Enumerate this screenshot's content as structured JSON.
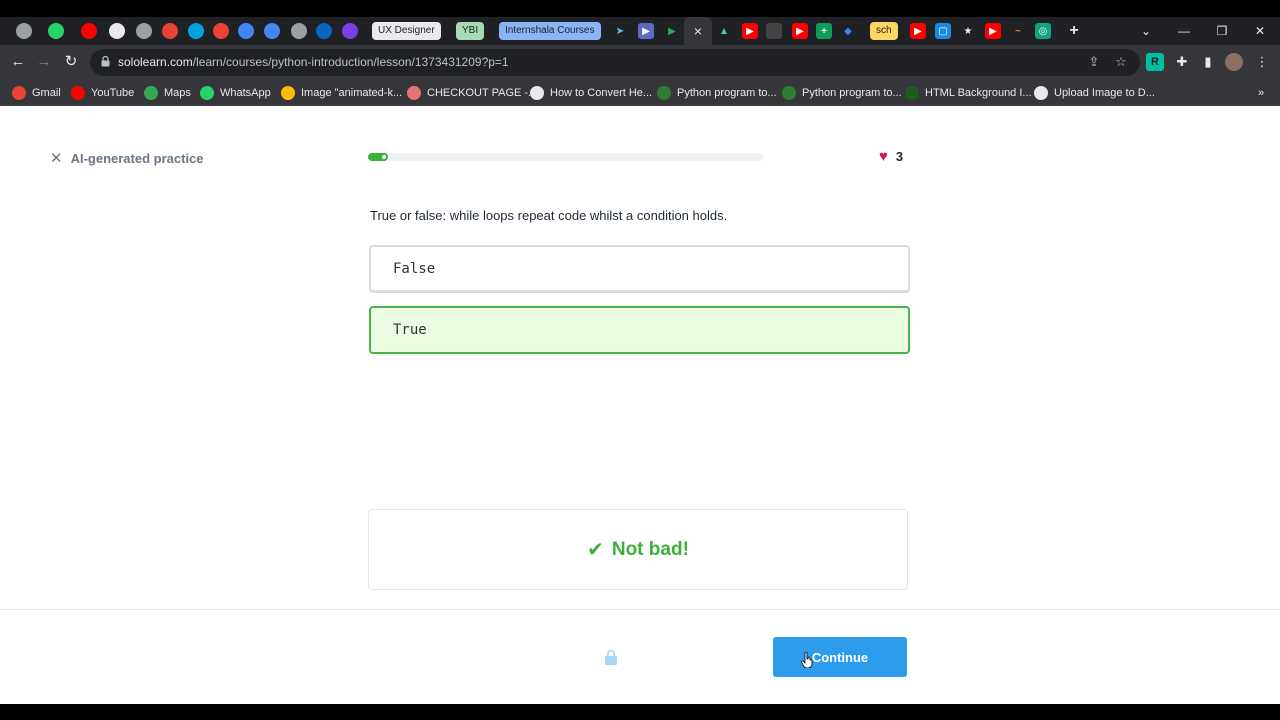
{
  "browser": {
    "tabs": [
      {
        "icon": "globe-icon",
        "color": "#9aa0a6"
      },
      {
        "icon": "whatsapp-icon",
        "color": "#25d366"
      },
      {
        "icon": "youtube-icon",
        "color": "#ff0000"
      },
      {
        "icon": "github-icon",
        "color": "#e8eaed"
      },
      {
        "icon": "globe-icon",
        "color": "#9aa0a6"
      },
      {
        "icon": "gmail-icon",
        "color": "#ea4335"
      },
      {
        "icon": "is-icon",
        "color": "#00a3e0"
      },
      {
        "icon": "gmail-icon",
        "color": "#ea4335"
      },
      {
        "icon": "kotlin-icon",
        "color": "#4285f4"
      },
      {
        "icon": "kotlin-icon",
        "color": "#4285f4"
      },
      {
        "icon": "globe-icon",
        "color": "#9aa0a6"
      },
      {
        "icon": "linkedin-icon",
        "color": "#0a66c2"
      },
      {
        "icon": "u-icon",
        "color": "#7b3fe4"
      }
    ],
    "chips": [
      {
        "label": "UX Designer",
        "color": "#e8eaed"
      },
      {
        "label": "YBI",
        "color": "#a8dab5"
      },
      {
        "label": "Internshala Courses",
        "color": "#8ab4f8"
      }
    ],
    "active_tab_close": "×",
    "url_host": "sololearn.com",
    "url_path": "/learn/courses/python-introduction/lesson/1373431209?p=1",
    "sch_chip": "sch",
    "bookmarks": [
      {
        "label": "Gmail",
        "color": "#ea4335"
      },
      {
        "label": "YouTube",
        "color": "#ff0000"
      },
      {
        "label": "Maps",
        "color": "#34a853"
      },
      {
        "label": "WhatsApp",
        "color": "#25d366"
      },
      {
        "label": "Image \"animated-k...",
        "color": "#fbbc04"
      },
      {
        "label": "CHECKOUT PAGE -...",
        "color": "#e57373"
      },
      {
        "label": "How to Convert He...",
        "color": "#e8eaed"
      },
      {
        "label": "Python program to...",
        "color": "#2e7d32"
      },
      {
        "label": "Python program to...",
        "color": "#2e7d32"
      },
      {
        "label": "HTML Background I...",
        "color": "#1b5e20"
      },
      {
        "label": "Upload Image to D...",
        "color": "#e8eaed"
      }
    ],
    "more_bookmarks": "»"
  },
  "lesson": {
    "close_label": "AI-generated practice",
    "progress_fraction": 0.05,
    "lives": "3",
    "question": "True or false: while loops repeat code whilst a condition holds.",
    "options": [
      {
        "label": "False",
        "selected": false
      },
      {
        "label": "True",
        "selected": true
      }
    ],
    "feedback": "Not bad!",
    "continue_label": "Continue"
  },
  "colors": {
    "accent": "#2d9cec",
    "success": "#3bb13b",
    "heart": "#d4145a"
  }
}
